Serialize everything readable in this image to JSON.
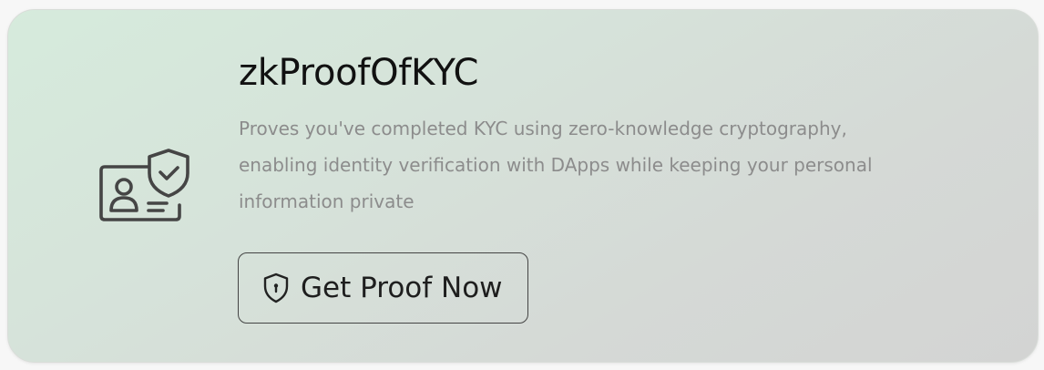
{
  "card": {
    "title": "zkProofOfKYC",
    "description": "Proves you've completed KYC using zero-knowledge cryptography, enabling identity verification with DApps while keeping your personal information private",
    "icon": "id-card-shield-check-icon",
    "button": {
      "label": "Get Proof Now",
      "icon": "shield-keyhole-icon"
    }
  },
  "colors": {
    "text_primary": "#111111",
    "text_secondary": "#8c8c8c",
    "card_gradient_start": "#d6ebdc",
    "card_gradient_end": "#d3d4d3",
    "icon_stroke": "#444444"
  }
}
